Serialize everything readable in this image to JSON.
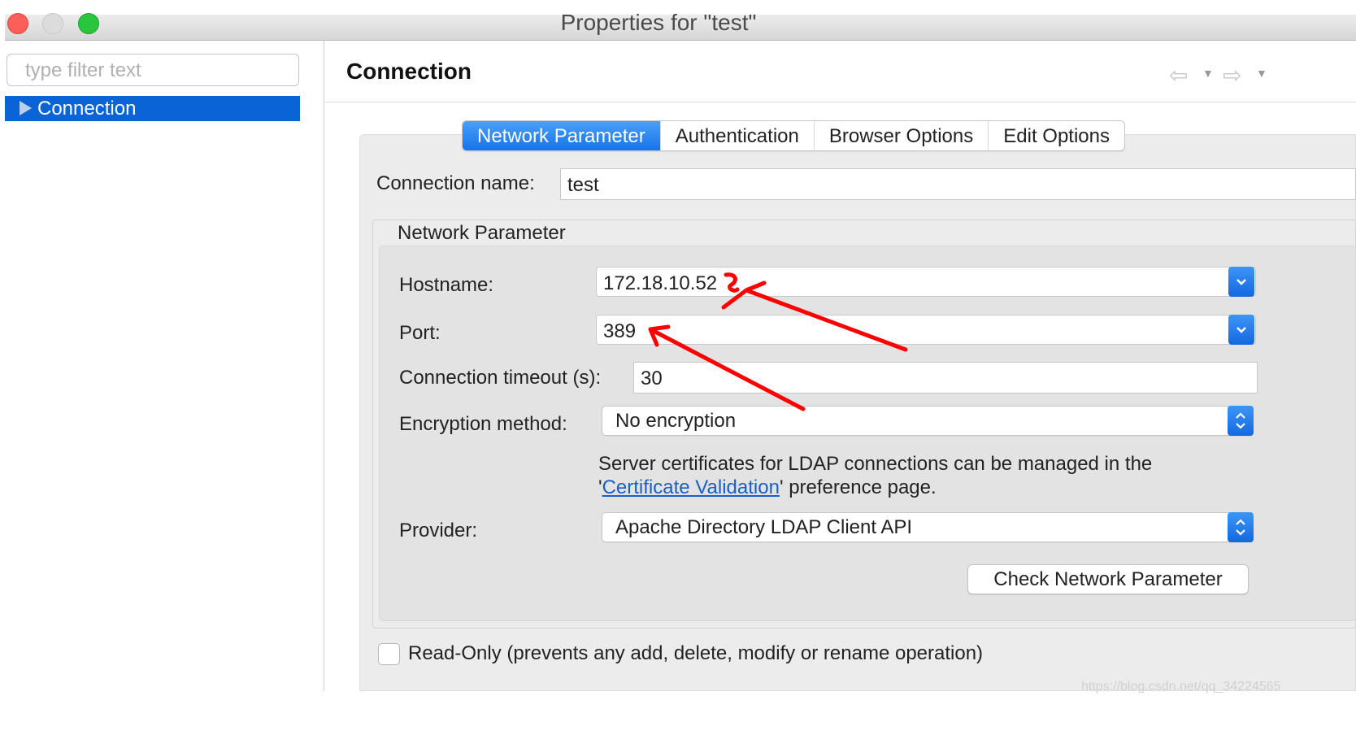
{
  "window": {
    "title": "Properties for \"test\""
  },
  "left_panel": {
    "filter_placeholder": "type filter text",
    "tree": [
      {
        "label": "Connection",
        "selected": true
      }
    ]
  },
  "page": {
    "title": "Connection",
    "back_icon": "back-arrow-icon",
    "forward_icon": "forward-arrow-icon"
  },
  "tabs": [
    {
      "label": "Network Parameter",
      "active": true
    },
    {
      "label": "Authentication",
      "active": false
    },
    {
      "label": "Browser Options",
      "active": false
    },
    {
      "label": "Edit Options",
      "active": false
    }
  ],
  "form": {
    "connection_name_label": "Connection name:",
    "connection_name_value": "test",
    "group_title": "Network Parameter",
    "hostname_label": "Hostname:",
    "hostname_value": "172.18.10.52",
    "port_label": "Port:",
    "port_value": "389",
    "timeout_label": "Connection timeout (s):",
    "timeout_value": "30",
    "encryption_label": "Encryption method:",
    "encryption_value": "No encryption",
    "cert_note_line1": "Server certificates for LDAP connections can be managed in the",
    "cert_note_prefix": "'",
    "cert_link": "Certificate Validation",
    "cert_note_suffix": "' preference page.",
    "provider_label": "Provider:",
    "provider_value": "Apache Directory LDAP Client API",
    "check_button": "Check Network Parameter",
    "readonly_label": "Read-Only (prevents any add, delete, modify or rename operation)",
    "readonly_checked": false
  },
  "annotation_color": "#ff0000",
  "watermark": "https://blog.csdn.net/qq_34224565"
}
